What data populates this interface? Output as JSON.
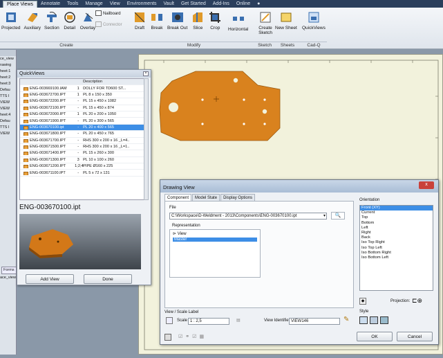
{
  "ribbon": {
    "tabs": [
      "Place Views",
      "Annotate",
      "Tools",
      "Manage",
      "View",
      "Environments",
      "Vault",
      "Get Started",
      "Add-Ins",
      "Online",
      "●"
    ],
    "create_tools": [
      "Projected",
      "Auxiliary",
      "Section",
      "Detail",
      "Overlay"
    ],
    "nailboard_label": "Nailboard",
    "connector_label": "Connector",
    "modify_tools": [
      "Draft",
      "Break",
      "Break Out",
      "Slice",
      "Crop"
    ],
    "horizontal_label": "Horizontal",
    "create_sketch_label": "Create Sketch",
    "new_sheet_label": "New Sheet",
    "quickviews_label": "QuickViews",
    "groups": {
      "create": "Create",
      "modify": "Modify",
      "sketch": "Sketch",
      "sheets": "Sheets",
      "cadq": "Cad-Q"
    }
  },
  "browser": {
    "items": [
      "ce_view",
      "rawing",
      "heet:1",
      "heet:2",
      "heet:3",
      "Defau",
      "TTS I",
      "VIEW",
      "VIEW",
      "heet:4",
      "Defau",
      "TTS I",
      "VIEW"
    ],
    "forms_label": "Forms",
    "bottom_item": "ace_view"
  },
  "quickviews": {
    "title": "QuickViews",
    "header_description": "Description",
    "rows": [
      {
        "name": "ENG-003669100.IAM",
        "qty": "1",
        "desc": "DOLLY FOR TD600 ST..."
      },
      {
        "name": "ENG-003672700.IPT",
        "qty": "1",
        "desc": "PL 8 x 150 x 350"
      },
      {
        "name": "ENG-003672200.IPT",
        "qty": "-",
        "desc": "PL 15 x 450 x 1082"
      },
      {
        "name": "ENG-003672100.IPT",
        "qty": "-",
        "desc": "PL 15 x 450 x 874"
      },
      {
        "name": "ENG-003672000.IPT",
        "qty": "1",
        "desc": "PL 20 x 200 x 1050"
      },
      {
        "name": "ENG-003671900.IPT",
        "qty": "-",
        "desc": "PL 20 x 300 x 565"
      },
      {
        "name": "ENG-003670100.ipt",
        "qty": "-",
        "desc": "PL 20 x 400 x 565"
      },
      {
        "name": "ENG-003671800.IPT",
        "qty": "-",
        "desc": "PL 20 x 450 x 765"
      },
      {
        "name": "ENG-003671700.IPT",
        "qty": "-",
        "desc": "RHS 300 x 200 x 16 _L=4.."
      },
      {
        "name": "ENG-003671500.IPT",
        "qty": "-",
        "desc": "RHS 300 x 200 x 16 _L=1.."
      },
      {
        "name": "ENG-003671400.IPT",
        "qty": "-",
        "desc": "PL 15 x 260 x 300"
      },
      {
        "name": "ENG-003671300.IPT",
        "qty": "3",
        "desc": "PL 10 x 100 x 260"
      },
      {
        "name": "ENG-003671200.IPT",
        "qty": "1;2;4",
        "desc": "PIPE Ø160 x 225"
      },
      {
        "name": "ENG-003671100.IPT",
        "qty": "-",
        "desc": "PL 5 x 72 x 131"
      }
    ],
    "selected_index": 6,
    "preview_name": "ENG-003670100.ipt",
    "add_view_label": "Add View",
    "done_label": "Done"
  },
  "drawing_view": {
    "title": "Drawing View",
    "tabs": [
      "Component",
      "Model State",
      "Display Options"
    ],
    "file_label": "File",
    "file_path": "C:\\Workspace\\D-Weldment - 2013\\Components\\ENG-003670100.ipt",
    "representation_label": "Representation",
    "view_label": "View",
    "view_value": "Master",
    "orientation_label": "Orientation",
    "orientations": [
      "Front (XY)",
      "Current",
      "Top",
      "Bottom",
      "Left",
      "Right",
      "Back",
      "Iso Top Right",
      "Iso Top Left",
      "Iso Bottom Right",
      "Iso Bottom Left"
    ],
    "selected_orientation": 0,
    "projection_label": "Projection:",
    "scale_group_label": "View / Scale Label",
    "scale_label": "Scale",
    "scale_value": "1 : 2,5",
    "view_identifier_label": "View Identifier",
    "view_identifier_value": "VIEW146",
    "style_label": "Style",
    "ok_label": "OK",
    "cancel_label": "Cancel"
  },
  "colors": {
    "part_orange": "#d9821e",
    "selection_blue": "#3d8ee6",
    "ribbon_dark": "#2b3f5c"
  }
}
